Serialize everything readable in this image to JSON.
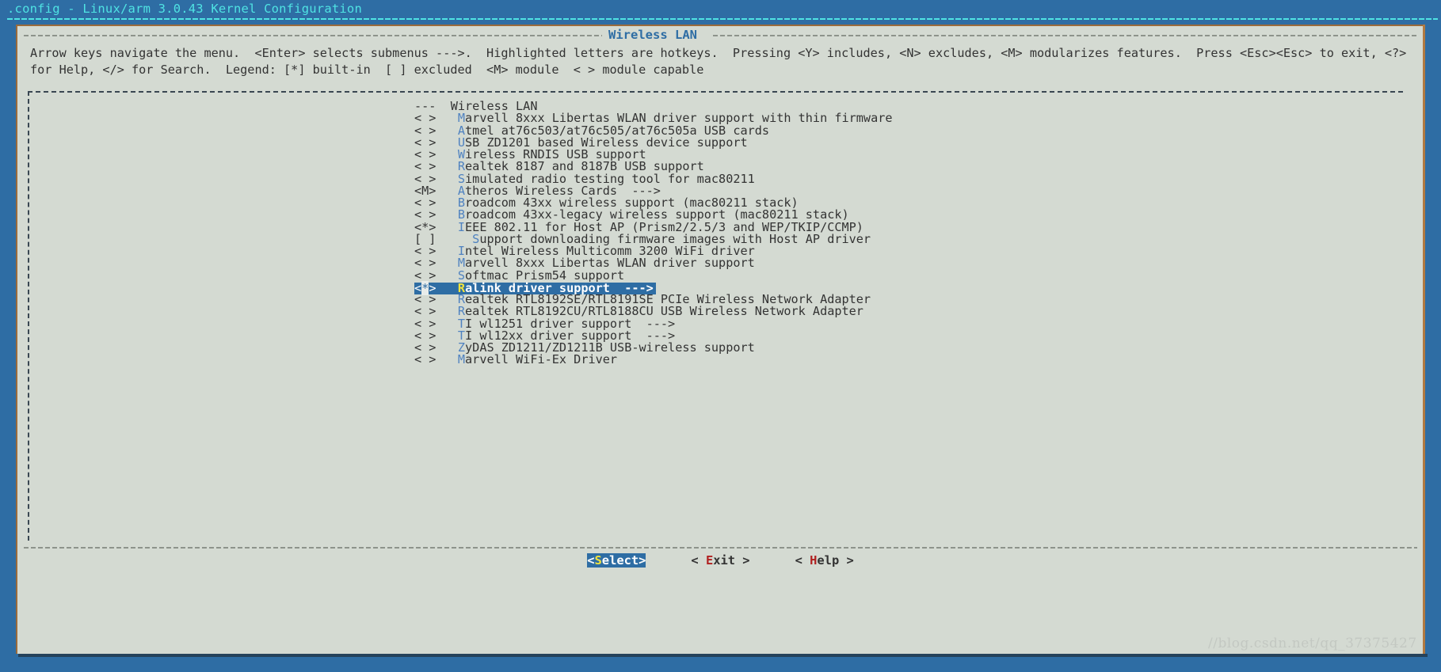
{
  "window": {
    "title": ".config - Linux/arm 3.0.43 Kernel Configuration",
    "accent_cyan": "#4fe3e3",
    "accent_blue": "#2e6da4",
    "dialog_bg": "#d4dad2"
  },
  "dialog": {
    "frame_title": "Wireless LAN",
    "help_text": "Arrow keys navigate the menu.  <Enter> selects submenus --->.  Highlighted letters are hotkeys.  Pressing <Y> includes, <N> excludes, <M> modularizes features.  Press <Esc><Esc> to exit, <?> for Help, </> for Search.  Legend: [*] built-in  [ ] excluded  <M> module  < > module capable"
  },
  "menu": {
    "rows": [
      {
        "mark": "---",
        "gap": "  ",
        "hot": "",
        "text": "Wireless LAN",
        "selected": false,
        "kind": "header"
      },
      {
        "mark": "< >",
        "gap": "   ",
        "hot": "M",
        "text": "arvell 8xxx Libertas WLAN driver support with thin firmware",
        "selected": false,
        "kind": "tristate"
      },
      {
        "mark": "< >",
        "gap": "   ",
        "hot": "A",
        "text": "tmel at76c503/at76c505/at76c505a USB cards",
        "selected": false,
        "kind": "tristate"
      },
      {
        "mark": "< >",
        "gap": "   ",
        "hot": "U",
        "text": "SB ZD1201 based Wireless device support",
        "selected": false,
        "kind": "tristate"
      },
      {
        "mark": "< >",
        "gap": "   ",
        "hot": "W",
        "text": "ireless RNDIS USB support",
        "selected": false,
        "kind": "tristate"
      },
      {
        "mark": "< >",
        "gap": "   ",
        "hot": "R",
        "text": "ealtek 8187 and 8187B USB support",
        "selected": false,
        "kind": "tristate"
      },
      {
        "mark": "< >",
        "gap": "   ",
        "hot": "S",
        "text": "imulated radio testing tool for mac80211",
        "selected": false,
        "kind": "tristate"
      },
      {
        "mark": "<M>",
        "gap": "   ",
        "hot": "A",
        "text": "theros Wireless Cards  --->",
        "selected": false,
        "kind": "module"
      },
      {
        "mark": "< >",
        "gap": "   ",
        "hot": "B",
        "text": "roadcom 43xx wireless support (mac80211 stack)",
        "selected": false,
        "kind": "tristate"
      },
      {
        "mark": "< >",
        "gap": "   ",
        "hot": "B",
        "text": "roadcom 43xx-legacy wireless support (mac80211 stack)",
        "selected": false,
        "kind": "tristate"
      },
      {
        "mark": "<*>",
        "gap": "   ",
        "hot": "I",
        "text": "EEE 802.11 for Host AP (Prism2/2.5/3 and WEP/TKIP/CCMP)",
        "selected": false,
        "kind": "builtin"
      },
      {
        "mark": "[ ]",
        "gap": "     ",
        "hot": "S",
        "text": "upport downloading firmware images with Host AP driver",
        "selected": false,
        "kind": "bool"
      },
      {
        "mark": "< >",
        "gap": "   ",
        "hot": "I",
        "text": "ntel Wireless Multicomm 3200 WiFi driver",
        "selected": false,
        "kind": "tristate"
      },
      {
        "mark": "< >",
        "gap": "   ",
        "hot": "M",
        "text": "arvell 8xxx Libertas WLAN driver support",
        "selected": false,
        "kind": "tristate"
      },
      {
        "mark": "< >",
        "gap": "   ",
        "hot": "S",
        "text": "oftmac Prism54 support",
        "selected": false,
        "kind": "tristate"
      },
      {
        "mark": "<*>",
        "gap": "   ",
        "hot": "R",
        "text": "alink driver support  --->",
        "selected": true,
        "kind": "builtin"
      },
      {
        "mark": "< >",
        "gap": "   ",
        "hot": "R",
        "text": "ealtek RTL8192SE/RTL8191SE PCIe Wireless Network Adapter",
        "selected": false,
        "kind": "tristate"
      },
      {
        "mark": "< >",
        "gap": "   ",
        "hot": "R",
        "text": "ealtek RTL8192CU/RTL8188CU USB Wireless Network Adapter",
        "selected": false,
        "kind": "tristate"
      },
      {
        "mark": "< >",
        "gap": "   ",
        "hot": "T",
        "text": "I wl1251 driver support  --->",
        "selected": false,
        "kind": "tristate"
      },
      {
        "mark": "< >",
        "gap": "   ",
        "hot": "T",
        "text": "I wl12xx driver support  --->",
        "selected": false,
        "kind": "tristate"
      },
      {
        "mark": "< >",
        "gap": "   ",
        "hot": "Z",
        "text": "yDAS ZD1211/ZD1211B USB-wireless support",
        "selected": false,
        "kind": "tristate"
      },
      {
        "mark": "< >",
        "gap": "   ",
        "hot": "M",
        "text": "arvell WiFi-Ex Driver",
        "selected": false,
        "kind": "tristate"
      }
    ],
    "selected_index": 15,
    "cursor_char": "*"
  },
  "buttons": [
    {
      "pre": "<",
      "hotkey": "S",
      "post": "elect>",
      "active": true,
      "name": "select"
    },
    {
      "pre": "< ",
      "hotkey": "E",
      "post": "xit >",
      "active": false,
      "name": "exit"
    },
    {
      "pre": "< ",
      "hotkey": "H",
      "post": "elp >",
      "active": false,
      "name": "help"
    }
  ],
  "watermark": "//blog.csdn.net/qq_37375427"
}
